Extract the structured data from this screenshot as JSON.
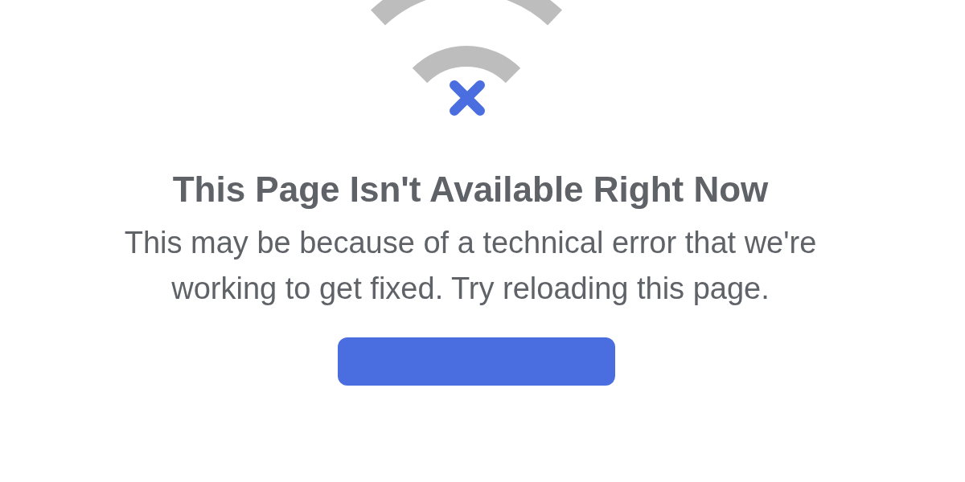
{
  "error": {
    "title": "This Page Isn't Available Right Now",
    "message": "This may be because of a technical error that we're working to get fixed. Try reloading this page."
  },
  "reload_button": {
    "kind": "button"
  }
}
